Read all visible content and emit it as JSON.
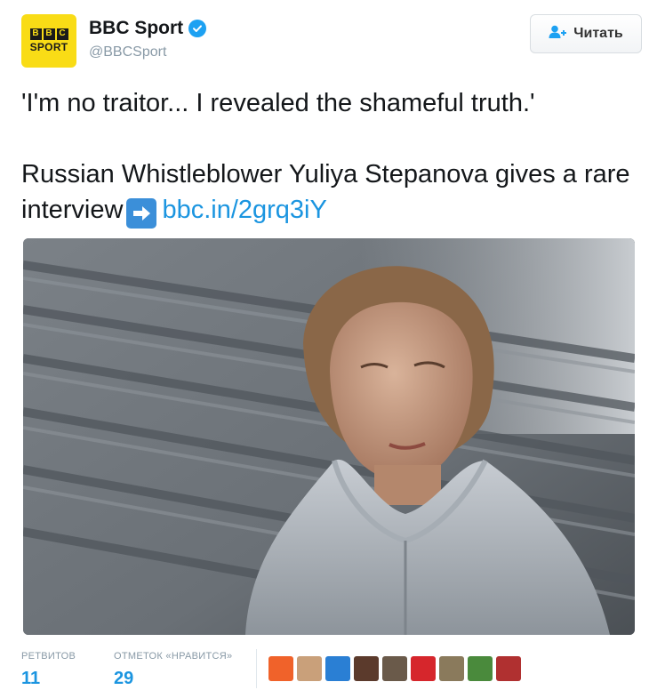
{
  "account": {
    "avatar_logo_blocks": [
      "B",
      "B",
      "C"
    ],
    "avatar_logo_word": "SPORT",
    "display_name": "BBC Sport",
    "handle": "@BBCSport",
    "verified_icon": "verified-check-icon"
  },
  "follow_button": {
    "label": "Читать",
    "icon": "follow-user-plus-icon"
  },
  "tweet": {
    "line1": "'I'm no traitor... I revealed the shameful truth.'",
    "line2": "Russian Whistleblower Yuliya Stepanova gives a rare interview",
    "emoji_icon": "right-arrow-emoji-icon",
    "link": "bbc.in/2grq3iY"
  },
  "stats": {
    "retweets_label": "РЕТВИТОВ",
    "retweets_count": "11",
    "likes_label": "ОТМЕТОК «НРАВИТСЯ»",
    "likes_count": "29"
  },
  "colors": {
    "accent": "#1b95e0",
    "verified": "#1da1f2",
    "bbc_yellow": "#f9dc16",
    "muted": "#8899a6"
  },
  "likers": [
    {
      "name": "liker-avatar-1",
      "color": "#f0622a"
    },
    {
      "name": "liker-avatar-2",
      "color": "#c9a07a"
    },
    {
      "name": "liker-avatar-3",
      "color": "#2a7fd4"
    },
    {
      "name": "liker-avatar-4",
      "color": "#5b3a2c"
    },
    {
      "name": "liker-avatar-5",
      "color": "#6a5a4a"
    },
    {
      "name": "liker-avatar-6",
      "color": "#d6262c"
    },
    {
      "name": "liker-avatar-7",
      "color": "#8a7a5c"
    },
    {
      "name": "liker-avatar-8",
      "color": "#4a8a3c"
    },
    {
      "name": "liker-avatar-9",
      "color": "#b03030"
    }
  ]
}
